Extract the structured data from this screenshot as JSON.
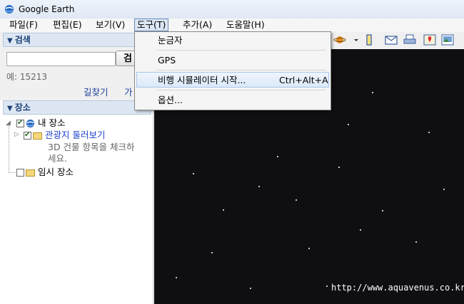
{
  "window": {
    "title": "Google Earth"
  },
  "menubar": {
    "items": [
      {
        "label": "파일(F)"
      },
      {
        "label": "편집(E)"
      },
      {
        "label": "보기(V)"
      },
      {
        "label": "도구(T)"
      },
      {
        "label": "추가(A)"
      },
      {
        "label": "도움말(H)"
      }
    ]
  },
  "tools_menu": {
    "items": [
      {
        "label": "눈금자",
        "shortcut": ""
      },
      {
        "label": "GPS",
        "shortcut": ""
      },
      {
        "label": "비행 시뮬레이터 시작...",
        "shortcut": "Ctrl+Alt+A"
      },
      {
        "label": "옵션...",
        "shortcut": ""
      }
    ],
    "highlighted_index": 2
  },
  "search": {
    "header": "검색",
    "input_value": "",
    "button_label": "검",
    "example": "예: 15213",
    "link_directions": "길찾기",
    "link_more": "가"
  },
  "places": {
    "header": "장소",
    "my_places": "내 장소",
    "sightseeing": "관광지 둘러보기",
    "sightseeing_note_line1": "3D 건물 항목을 체크하",
    "sightseeing_note_line2": "세요.",
    "temporary_places": "임시 장소"
  },
  "watermark": "http://www.aquavenus.co.kr",
  "colors": {
    "accent": "#1c3f78",
    "link": "#1c3f98",
    "map_background": "#0f0f12",
    "menu_highlight": "#dbe9f9"
  },
  "icons": [
    "globe-icon",
    "planet-icon",
    "ruler-icon",
    "email-icon",
    "print-icon",
    "google-maps-icon",
    "save-image-icon"
  ]
}
